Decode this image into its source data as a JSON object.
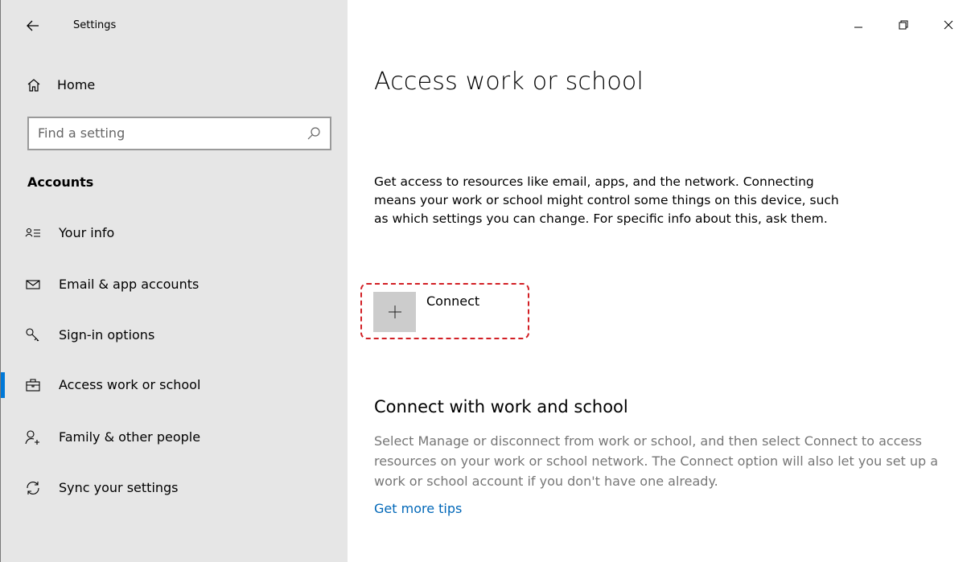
{
  "window": {
    "title": "Settings",
    "controls": {
      "minimize_icon": "minimize-icon",
      "restore_icon": "restore-icon",
      "close_icon": "close-icon"
    }
  },
  "sidebar": {
    "home_label": "Home",
    "search_placeholder": "Find a setting",
    "section": "Accounts",
    "items": [
      {
        "label": "Your info",
        "icon": "person-info-icon",
        "selected": false
      },
      {
        "label": "Email & app accounts",
        "icon": "mail-icon",
        "selected": false
      },
      {
        "label": "Sign-in options",
        "icon": "key-icon",
        "selected": false
      },
      {
        "label": "Access work or school",
        "icon": "briefcase-icon",
        "selected": true
      },
      {
        "label": "Family & other people",
        "icon": "add-person-icon",
        "selected": false
      },
      {
        "label": "Sync your settings",
        "icon": "sync-icon",
        "selected": false
      }
    ]
  },
  "main": {
    "title": "Access work or school",
    "description": "Get access to resources like email, apps, and the network. Connecting means your work or school might control some things on this device, such as which settings you can change. For specific info about this, ask them.",
    "connect_label": "Connect",
    "sub_heading": "Connect with work and school",
    "sub_description": "Select Manage or disconnect from work or school, and then select Connect to access resources on your work or school network. The Connect option will also let you set up a work or school account if you don't have one already.",
    "tips_link": "Get more tips"
  },
  "colors": {
    "accent": "#0078d7",
    "link": "#0067b8",
    "sidebar_bg": "#e6e6e6",
    "highlight_dashed": "#d21f25"
  }
}
